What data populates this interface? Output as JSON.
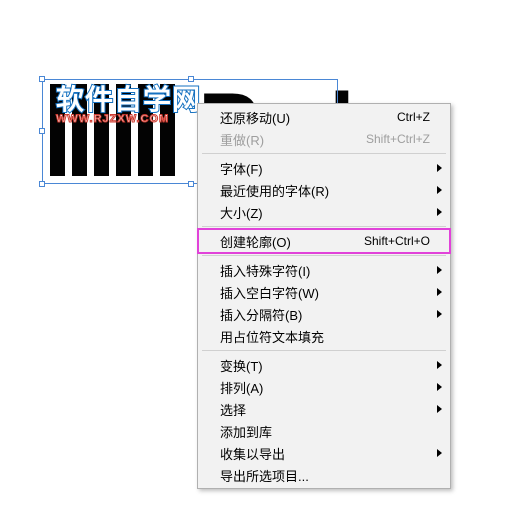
{
  "watermark": {
    "line1": "软件自学网",
    "line2": "WWW.RJZXW.COM"
  },
  "artwork": {
    "visible_text": "Pad"
  },
  "menu": {
    "undo_move": {
      "label": "还原移动(U)",
      "shortcut": "Ctrl+Z"
    },
    "redo": {
      "label": "重做(R)",
      "shortcut": "Shift+Ctrl+Z"
    },
    "font": {
      "label": "字体(F)"
    },
    "recent_fonts": {
      "label": "最近使用的字体(R)"
    },
    "size": {
      "label": "大小(Z)"
    },
    "create_outlines": {
      "label": "创建轮廓(O)",
      "shortcut": "Shift+Ctrl+O"
    },
    "insert_special": {
      "label": "插入特殊字符(I)"
    },
    "insert_whitespace": {
      "label": "插入空白字符(W)"
    },
    "insert_break": {
      "label": "插入分隔符(B)"
    },
    "fill_placeholder": {
      "label": "用占位符文本填充"
    },
    "transform": {
      "label": "变换(T)"
    },
    "arrange": {
      "label": "排列(A)"
    },
    "select": {
      "label": "选择"
    },
    "add_library": {
      "label": "添加到库"
    },
    "collect_export": {
      "label": "收集以导出"
    },
    "export_selection": {
      "label": "导出所选项目..."
    }
  }
}
